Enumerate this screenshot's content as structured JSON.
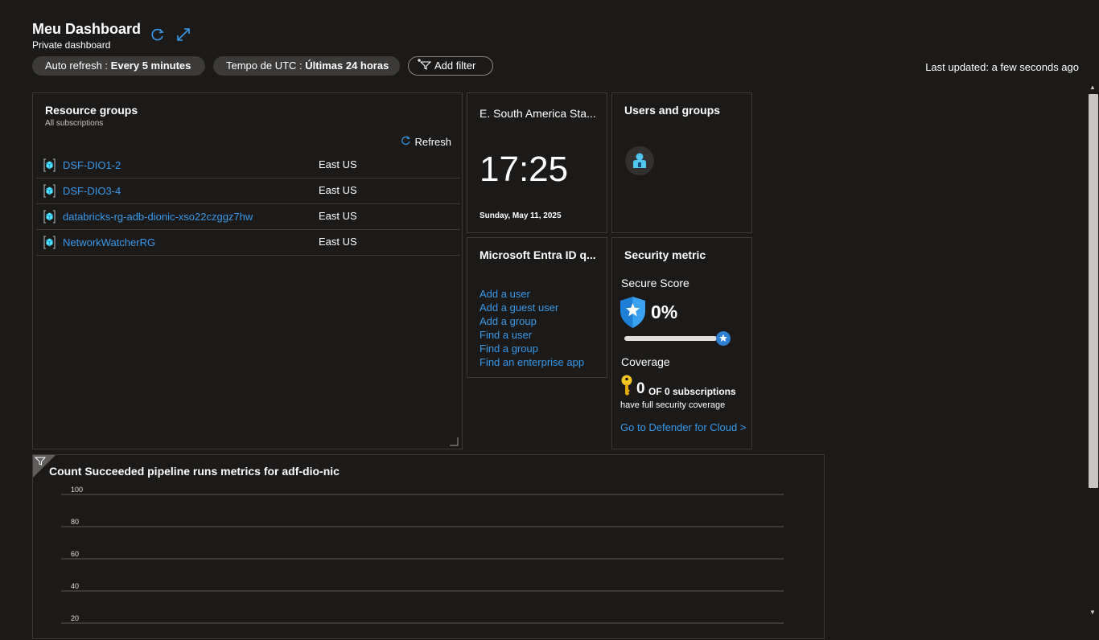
{
  "header": {
    "title": "Meu Dashboard",
    "subtitle": "Private dashboard",
    "last_updated": "Last updated: a few seconds ago"
  },
  "filters": {
    "auto_refresh_label": "Auto refresh :",
    "auto_refresh_value": "Every 5 minutes",
    "time_label": "Tempo de UTC :",
    "time_value": "Últimas 24 horas",
    "add_filter": "Add filter"
  },
  "resource_groups": {
    "title": "Resource groups",
    "subtitle": "All subscriptions",
    "refresh": "Refresh",
    "rows": [
      {
        "name": "DSF-DIO1-2",
        "location": "East US"
      },
      {
        "name": "DSF-DIO3-4",
        "location": "East US"
      },
      {
        "name": "databricks-rg-adb-dionic-xso22czggz7hw",
        "location": "East US"
      },
      {
        "name": "NetworkWatcherRG",
        "location": "East US"
      }
    ]
  },
  "clock": {
    "title": "E. South America Sta...",
    "time": "17:25",
    "date": "Sunday, May 11, 2025"
  },
  "users": {
    "title": "Users and groups"
  },
  "entra": {
    "title": "Microsoft Entra ID q...",
    "links": [
      "Add a user",
      "Add a guest user",
      "Add a group",
      "Find a user",
      "Find a group",
      "Find an enterprise app"
    ]
  },
  "security": {
    "title": "Security metric",
    "secure_score_label": "Secure Score",
    "secure_score_value": "0%",
    "secure_score_fraction": 0,
    "coverage_label": "Coverage",
    "coverage_count": "0",
    "coverage_of": "OF 0 subscriptions",
    "coverage_text": "have full security coverage",
    "defender_link": "Go to Defender for Cloud >"
  },
  "chart_data": {
    "type": "line",
    "title": "Count Succeeded pipeline runs metrics for adf-dio-nic",
    "y_ticks": [
      100,
      80,
      60,
      40,
      20
    ],
    "series": []
  },
  "colors": {
    "background": "#1b1a19",
    "link": "#3899e8",
    "pill": "#3b3a39",
    "accent": "#0078d4"
  }
}
